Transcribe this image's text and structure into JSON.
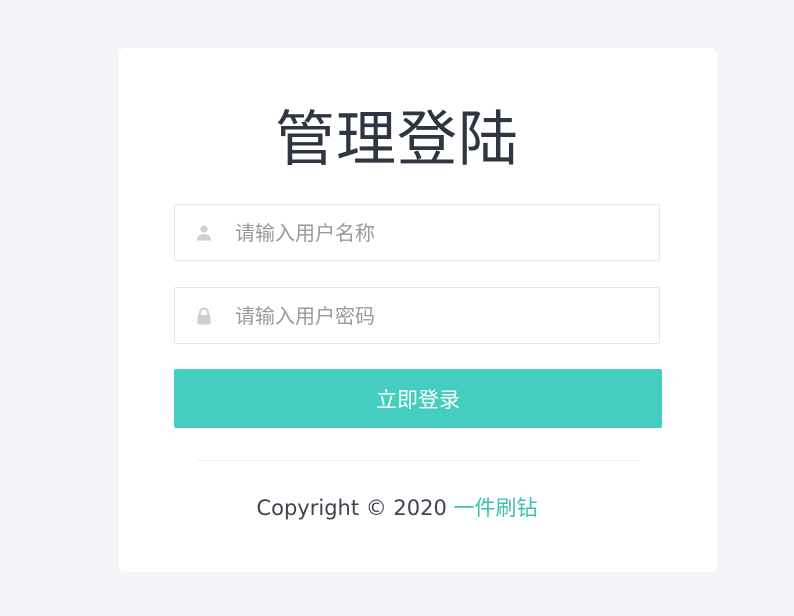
{
  "login": {
    "title": "管理登陆",
    "username_placeholder": "请输入用户名称",
    "password_placeholder": "请输入用户密码",
    "username_icon": "user-icon",
    "password_icon": "lock-icon",
    "submit_label": "立即登录"
  },
  "footer": {
    "copyright_text": "Copyright © 2020",
    "brand_link": "一件刷钻"
  },
  "colors": {
    "page_background": "#f3f5f9",
    "card_background": "#ffffff",
    "accent": "#45cdc1",
    "link": "#3cc0b1",
    "title_text": "#303641",
    "placeholder_text": "#999999",
    "icon": "#cfcfcf"
  }
}
